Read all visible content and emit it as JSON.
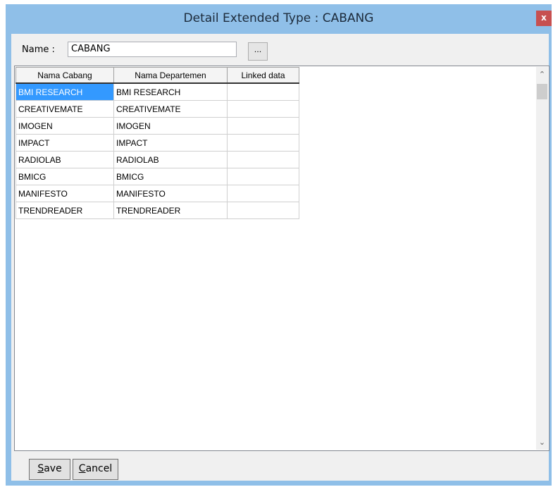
{
  "window": {
    "title": "Detail Extended Type : CABANG",
    "close_label": "x"
  },
  "name_field": {
    "label": "Name :",
    "value": "CABANG",
    "browse_label": "..."
  },
  "grid": {
    "columns": [
      "Nama Cabang",
      "Nama Departemen",
      "Linked data"
    ],
    "rows": [
      [
        "BMI RESEARCH",
        "BMI RESEARCH",
        ""
      ],
      [
        "CREATIVEMATE",
        "CREATIVEMATE",
        ""
      ],
      [
        "IMOGEN",
        "IMOGEN",
        ""
      ],
      [
        "IMPACT",
        "IMPACT",
        ""
      ],
      [
        "RADIOLAB",
        "RADIOLAB",
        ""
      ],
      [
        "BMICG",
        "BMICG",
        ""
      ],
      [
        "MANIFESTO",
        "MANIFESTO",
        ""
      ],
      [
        "TRENDREADER",
        "TRENDREADER",
        ""
      ]
    ],
    "selected_row": 0
  },
  "buttons": {
    "save": {
      "mnemonic": "S",
      "rest": "ave"
    },
    "cancel": {
      "mnemonic": "C",
      "rest": "ancel"
    }
  },
  "colors": {
    "frame": "#8fbfe8",
    "selection": "#3399ff",
    "close": "#c75050"
  }
}
